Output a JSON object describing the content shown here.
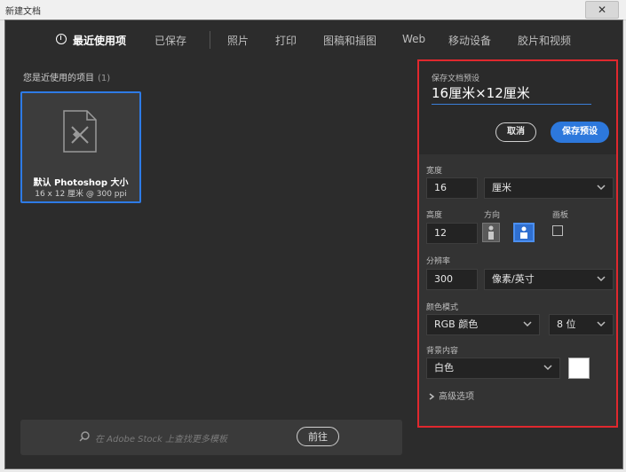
{
  "window": {
    "title": "新建文档",
    "close": "✕"
  },
  "tabs": [
    {
      "label": "最近使用项"
    },
    {
      "label": "已保存"
    },
    {
      "label": "照片"
    },
    {
      "label": "打印"
    },
    {
      "label": "图稿和插图"
    },
    {
      "label": "Web"
    },
    {
      "label": "移动设备"
    },
    {
      "label": "胶片和视频"
    }
  ],
  "recent": {
    "label": "您是近使用的项目",
    "count": "(1)",
    "items": [
      {
        "name": "默认 Photoshop 大小",
        "dims": "16 x 12 厘米 @ 300 ppi"
      }
    ]
  },
  "stock": {
    "placeholder": "在 Adobe Stock 上查找更多模板",
    "go_label": "前往"
  },
  "preset": {
    "section_label": "保存文档预设",
    "name_value": "16厘米×12厘米",
    "cancel_label": "取消",
    "save_label": "保存预设",
    "width_label": "宽度",
    "width_value": "16",
    "width_unit": "厘米",
    "height_label": "高度",
    "height_value": "12",
    "orientation_label": "方向",
    "artboard_label": "画板",
    "resolution_label": "分辨率",
    "resolution_value": "300",
    "resolution_unit": "像素/英寸",
    "color_mode_label": "颜色模式",
    "color_mode_value": "RGB 颜色",
    "bit_depth_value": "8 位",
    "background_label": "背景内容",
    "background_value": "白色",
    "background_color": "#ffffff",
    "advanced_label": "高级选项"
  },
  "colors": {
    "accent": "#2d78dc",
    "highlight_border": "#e0282e",
    "selected_card": "#2e7be6"
  }
}
